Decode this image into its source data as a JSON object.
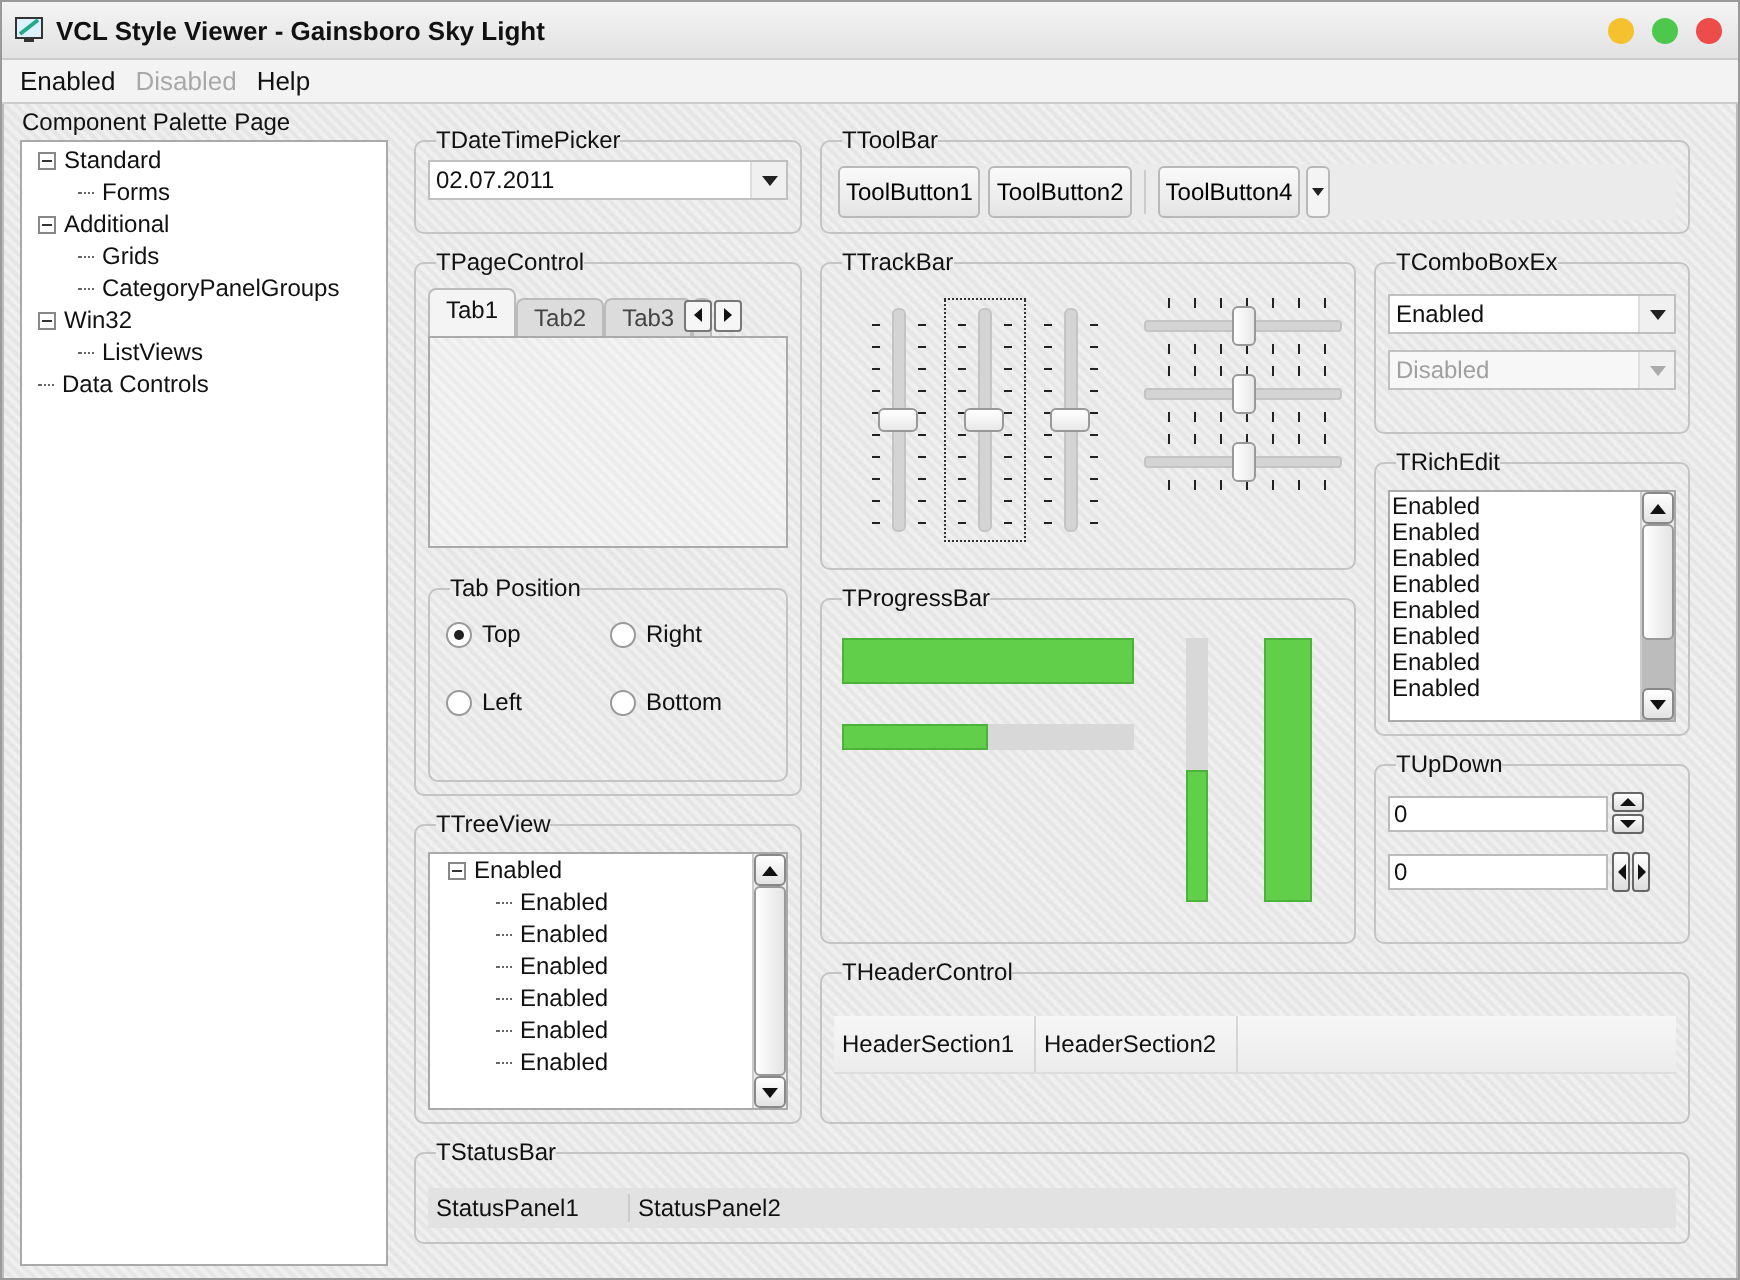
{
  "window": {
    "title": "VCL Style Viewer - Gainsboro Sky Light"
  },
  "menu": [
    {
      "label": "Enabled",
      "disabled": false
    },
    {
      "label": "Disabled",
      "disabled": true
    },
    {
      "label": "Help",
      "disabled": false
    }
  ],
  "palette": {
    "label": "Component Palette Page",
    "tree": [
      {
        "label": "Standard",
        "expanded": true,
        "children": [
          {
            "label": "Forms"
          }
        ]
      },
      {
        "label": "Additional",
        "expanded": true,
        "children": [
          {
            "label": "Grids"
          },
          {
            "label": "CategoryPanelGroups"
          }
        ]
      },
      {
        "label": "Win32",
        "expanded": true,
        "children": [
          {
            "label": "ListViews"
          }
        ]
      },
      {
        "label": "Data Controls"
      }
    ]
  },
  "date_time_picker": {
    "title": "TDateTimePicker",
    "value": "02.07.2011"
  },
  "toolbar": {
    "title": "TToolBar",
    "buttons": [
      {
        "label": "ToolButton1",
        "kind": "button"
      },
      {
        "label": "ToolButton2",
        "kind": "button"
      },
      {
        "kind": "separator"
      },
      {
        "label": "ToolButton4",
        "kind": "button"
      },
      {
        "kind": "dropdown"
      }
    ]
  },
  "page_control": {
    "title": "TPageControl",
    "tabs": [
      {
        "label": "Tab1",
        "selected": true
      },
      {
        "label": "Tab2",
        "selected": false
      },
      {
        "label": "Tab3",
        "selected": false
      }
    ],
    "tab_position": {
      "title": "Tab Position",
      "options": [
        {
          "label": "Top",
          "selected": true
        },
        {
          "label": "Right",
          "selected": false
        },
        {
          "label": "Left",
          "selected": false
        },
        {
          "label": "Bottom",
          "selected": false
        }
      ]
    }
  },
  "trackbar": {
    "title": "TTrackBar",
    "vertical": [
      {
        "level": 0.5,
        "focused": false
      },
      {
        "level": 0.5,
        "focused": true
      },
      {
        "level": 0.5,
        "focused": false
      }
    ],
    "horizontal": [
      {
        "level": 0.5
      },
      {
        "level": 0.5
      },
      {
        "level": 0.5
      }
    ]
  },
  "combo_box_ex": {
    "title": "TComboBoxEx",
    "items": [
      {
        "value": "Enabled",
        "disabled": false
      },
      {
        "value": "Disabled",
        "disabled": true
      }
    ]
  },
  "rich_edit": {
    "title": "TRichEdit",
    "lines": [
      "Enabled",
      "Enabled",
      "Enabled",
      "Enabled",
      "Enabled",
      "Enabled",
      "Enabled",
      "Enabled"
    ]
  },
  "progress_bar": {
    "title": "TProgressBar",
    "bars": [
      {
        "kind": "horizontal",
        "level": 1.0
      },
      {
        "kind": "horizontal",
        "level": 0.5
      },
      {
        "kind": "vertical",
        "level": 0.5
      },
      {
        "kind": "vertical",
        "level": 1.0
      }
    ]
  },
  "updown": {
    "title": "TUpDown",
    "fields": [
      {
        "value": "0",
        "kind": "vertical"
      },
      {
        "value": "0",
        "kind": "horizontal"
      }
    ]
  },
  "tree_view": {
    "title": "TTreeView",
    "root": {
      "label": "Enabled",
      "expanded": true,
      "children": [
        {
          "label": "Enabled"
        },
        {
          "label": "Enabled"
        },
        {
          "label": "Enabled"
        },
        {
          "label": "Enabled"
        },
        {
          "label": "Enabled"
        },
        {
          "label": "Enabled"
        }
      ]
    }
  },
  "header_control": {
    "title": "THeaderControl",
    "sections": [
      "HeaderSection1",
      "HeaderSection2"
    ]
  },
  "status_bar": {
    "title": "TStatusBar",
    "panels": [
      "StatusPanel1",
      "StatusPanel2"
    ]
  }
}
